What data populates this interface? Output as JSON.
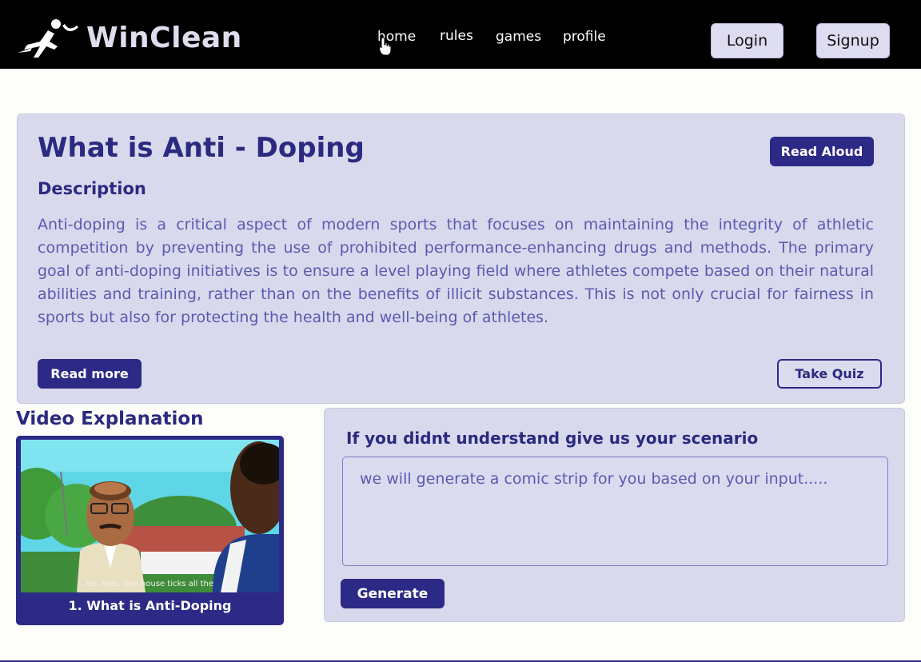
{
  "header": {
    "brand": "WinClean",
    "nav": [
      "home",
      "rules",
      "games",
      "profile"
    ],
    "login_label": "Login",
    "signup_label": "Signup"
  },
  "main": {
    "title": "What is Anti - Doping",
    "read_aloud_label": "Read Aloud",
    "description_heading": "Description",
    "description_text": "Anti-doping is a critical aspect of modern sports that focuses on maintaining the integrity of athletic competition by preventing the use of prohibited performance-enhancing drugs and methods. The primary goal of anti-doping initiatives is to ensure a level playing field where athletes compete based on their natural abilities and training, rather than on the benefits of illicit substances. This is not only crucial for fairness in sports but also for protecting the health and well-being of athletes.",
    "read_more_label": "Read more",
    "take_quiz_label": "Take Quiz"
  },
  "video": {
    "heading": "Video Explanation",
    "subtitle": "So, Alex, this house ticks all the",
    "caption": "1.  What is Anti-Doping"
  },
  "scenario": {
    "heading": "If you didnt understand give us your scenario",
    "placeholder": "we will generate a comic strip for you based on your input.....",
    "generate_label": "Generate"
  },
  "colors": {
    "primary": "#2c2a86",
    "card_bg": "#d9d9ed",
    "text_muted": "#5a5ab0",
    "nav_bg": "#000000"
  },
  "icons": {
    "logo": "runner-logo-icon",
    "cursor": "hand-pointer-icon"
  }
}
